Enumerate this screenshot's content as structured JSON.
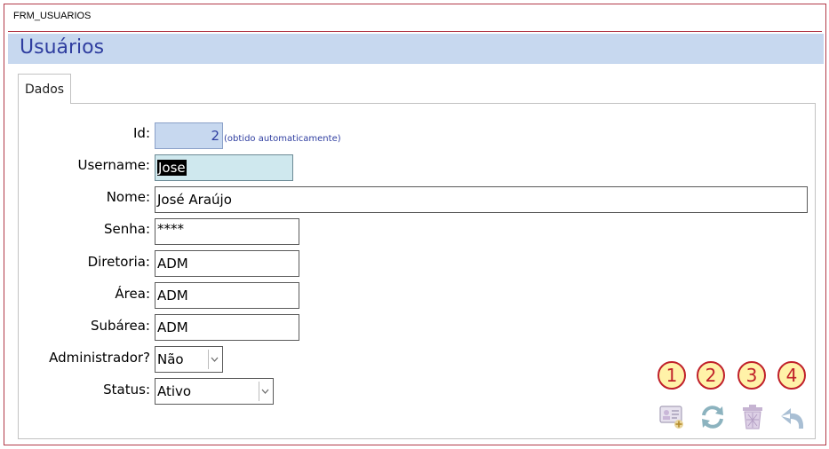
{
  "window": {
    "title": "FRM_USUARIOS"
  },
  "header": {
    "title": "Usuários"
  },
  "tabs": [
    {
      "label": "Dados"
    }
  ],
  "form": {
    "id": {
      "label": "Id:",
      "value": "2",
      "hint": "(obtido automaticamente)"
    },
    "username": {
      "label": "Username:",
      "value": "Jose"
    },
    "nome": {
      "label": "Nome:",
      "value": "José Araújo"
    },
    "senha": {
      "label": "Senha:",
      "value": "****"
    },
    "diretoria": {
      "label": "Diretoria:",
      "value": "ADM"
    },
    "area": {
      "label": "Área:",
      "value": "ADM"
    },
    "subarea": {
      "label": "Subárea:",
      "value": "ADM"
    },
    "administrador": {
      "label": "Administrador?",
      "value": "Não"
    },
    "status": {
      "label": "Status:",
      "value": "Ativo"
    }
  },
  "toolbar": {
    "badges": [
      "1",
      "2",
      "3",
      "4"
    ],
    "icons": [
      "new-user-card-icon",
      "refresh-icon",
      "trash-icon",
      "undo-back-icon"
    ]
  },
  "colors": {
    "accent": "#2f3ea0",
    "header_band": "#c7d8ef",
    "border_red": "#b23a48",
    "badge_fill": "#fff2a8",
    "badge_red": "#c0202a"
  }
}
